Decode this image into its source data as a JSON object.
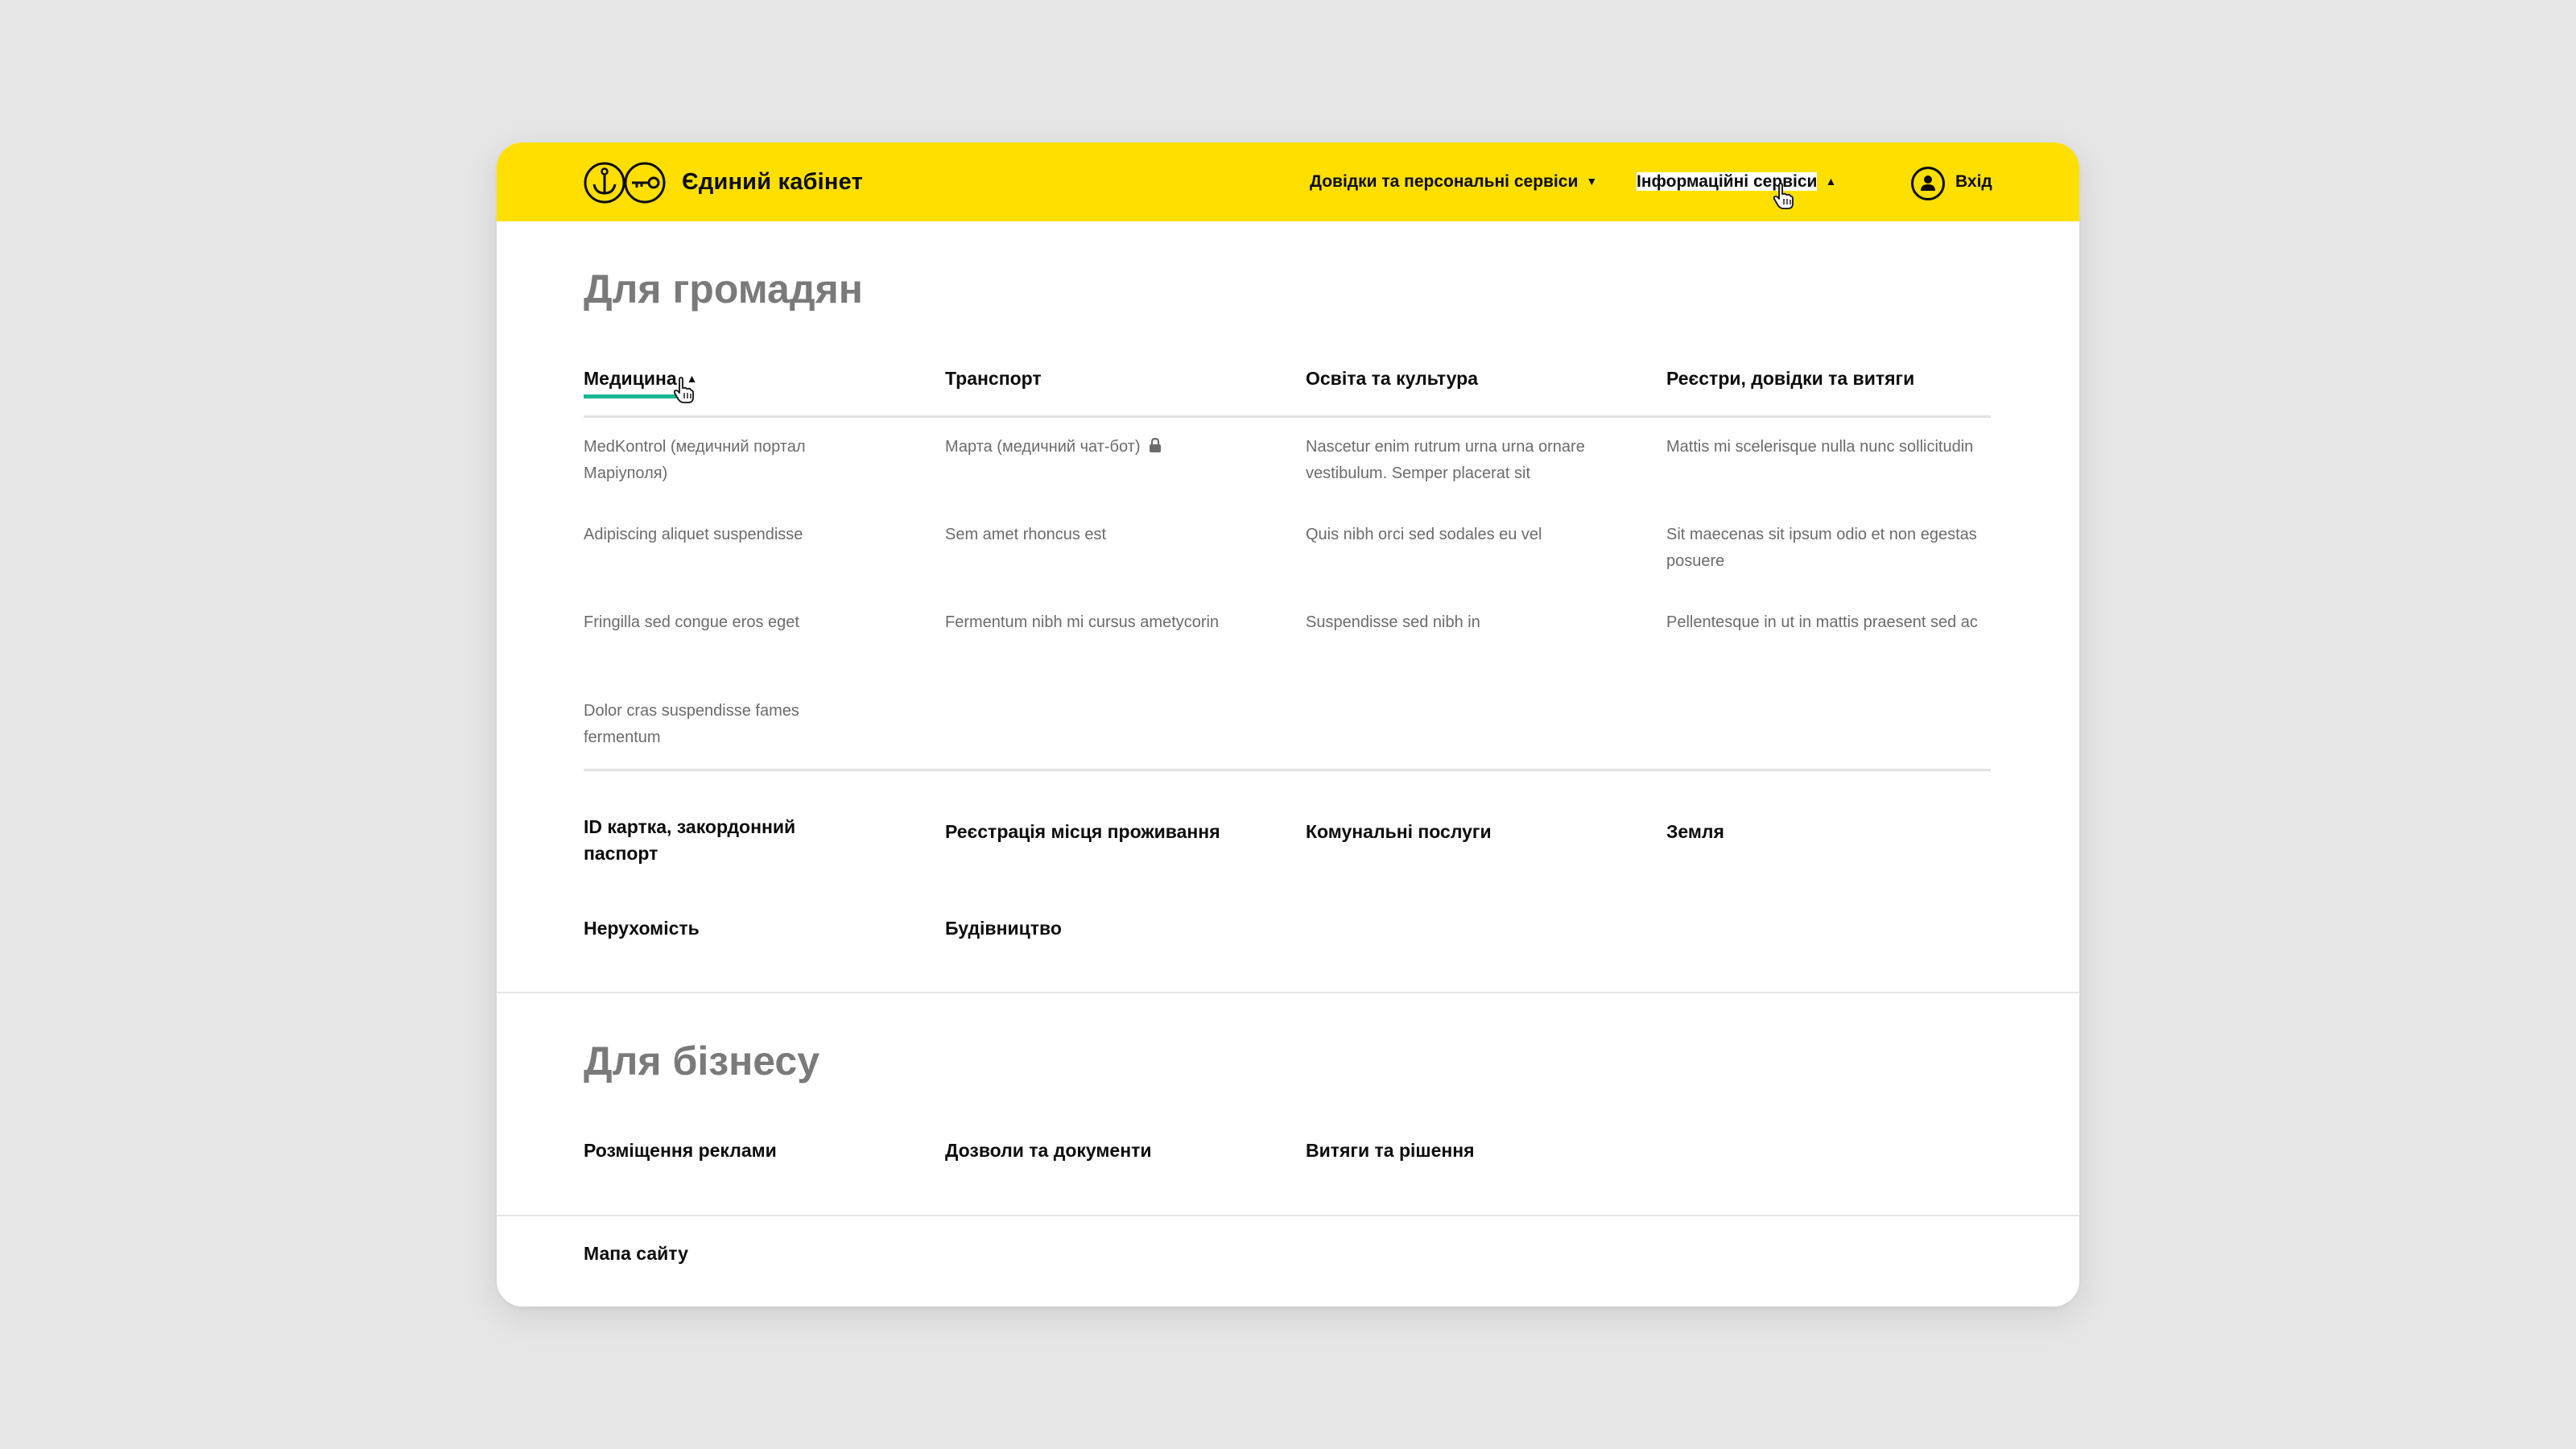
{
  "colors": {
    "header_bg": "#ffdf00",
    "accent_underline": "#18b892",
    "section_title": "#7a7a7a",
    "subitem_text": "#6b6b6b",
    "page_bg": "#e6e6e6"
  },
  "header": {
    "logo_icon": "anchor-key-logo",
    "brand": "Єдиний кабінет",
    "nav": [
      {
        "label": "Довідки та персональні сервіси",
        "state": "collapsed",
        "icon": "caret-down-icon"
      },
      {
        "label": "Інформаційні сервіси",
        "state": "expanded",
        "icon": "caret-up-icon"
      }
    ],
    "login": {
      "label": "Вхід",
      "icon": "user-circle-icon"
    }
  },
  "citizens": {
    "title": "Для громадян",
    "categories": [
      {
        "label": "Медицина",
        "active": true
      },
      {
        "label": "Транспорт"
      },
      {
        "label": "Освіта та культура"
      },
      {
        "label": "Реєстри, довідки та витяги"
      }
    ],
    "subitems": [
      [
        "MedKontrol (медичний портал Маріуполя)",
        "Adipiscing aliquet suspendisse",
        "Fringilla sed congue eros eget",
        "Dolor cras suspendisse fames fermentum"
      ],
      [
        "Марта (медичний чат-бот)",
        "Sem amet rhoncus est",
        "Fermentum nibh mi cursus ametycorin"
      ],
      [
        "Nascetur enim rutrum urna urna ornare vestibulum. Semper placerat sit",
        "Quis nibh orci sed sodales eu vel",
        "Suspendisse sed nibh in"
      ],
      [
        "Mattis mi scelerisque nulla nunc sollicitudin",
        "Sit maecenas sit ipsum odio et non egestas posuere",
        "Pellentesque in ut in mattis praesent sed ac"
      ]
    ],
    "locked_item_icon": "lock-icon",
    "more_categories": [
      "ID картка, закордонний паспорт",
      "Реєстрація місця проживання",
      "Комунальні послуги",
      "Земля",
      "Нерухомість",
      "Будівництво"
    ]
  },
  "business": {
    "title": "Для бізнесу",
    "categories": [
      "Розміщення реклами",
      "Дозволи та документи",
      "Витяги та рішення"
    ]
  },
  "footer": {
    "sitemap": "Мапа сайту"
  }
}
